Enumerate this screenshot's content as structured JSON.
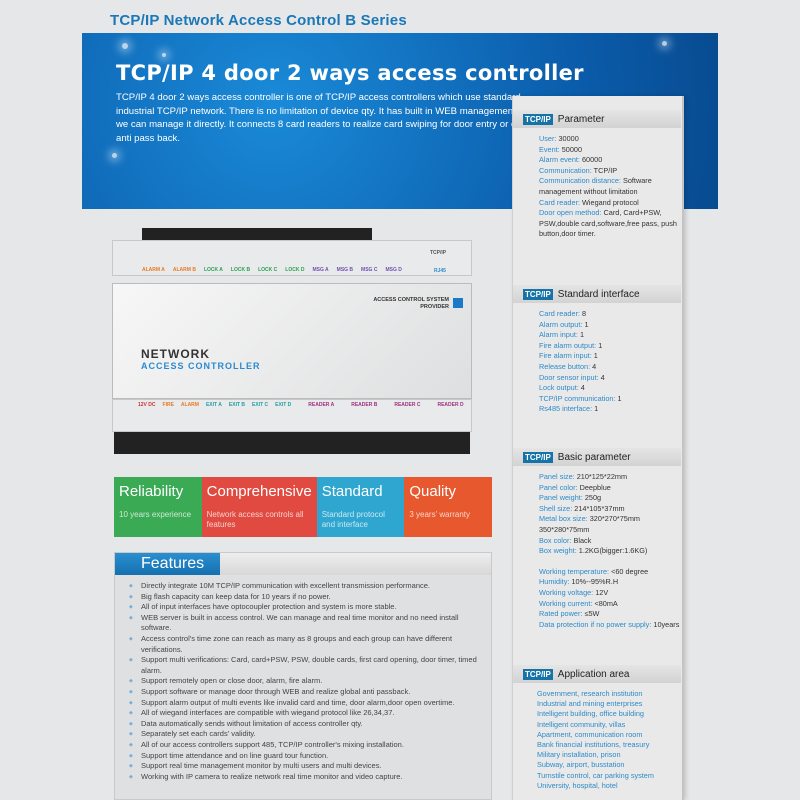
{
  "header": {
    "title": "TCP/IP Network Access Control  B  Series"
  },
  "banner": {
    "title": "TCP/IP 4 door  2 ways access controller",
    "description": "TCP/IP 4 door 2 ways access controller is one of TCP/IP access controllers which use standard industrial TCP/IP network. There is no limitation of device qty. It has built in WEB management and we can manage it directly. It connects 8 card readers to realize card swiping for door entry or exit and anti pass back."
  },
  "device": {
    "brand_line1": "NETWORK",
    "brand_line2": "ACCESS CONTROLLER",
    "provider": "ACCESS CONTROL SYSTEM PROVIDER",
    "port": "TCP/IP",
    "port_sub": "RJ45",
    "top_labels": [
      "ALARM A",
      "ALARM B",
      "LOCK A",
      "LOCK B",
      "LOCK C",
      "LOCK D",
      "MSG A",
      "MSG B",
      "MSG C",
      "MSG D"
    ],
    "bottom_labels": [
      "12V DC",
      "FIRE",
      "ALARM",
      "EXIT A",
      "EXIT B",
      "EXIT C",
      "EXIT D",
      "READER A",
      "READER B",
      "READER C",
      "READER D"
    ]
  },
  "cards": [
    {
      "title": "Reliability",
      "sub": "10 years experience",
      "color": "#3aaa55"
    },
    {
      "title": "Comprehensive",
      "sub": "Network access controls all features",
      "color": "#e04a40"
    },
    {
      "title": "Standard",
      "sub": "Standard protocol and interface",
      "color": "#2fa6d0"
    },
    {
      "title": "Quality",
      "sub": "3 years' warranty",
      "color": "#e8582e"
    }
  ],
  "features": {
    "title": "Features",
    "items": [
      "Directly integrate 10M TCP/IP communication with excellent transmission performance.",
      "Big flash capacity can keep data for 10 years if no power.",
      "All of input interfaces have optocoupler protection and system is more stable.",
      "WEB server is built in access control. We can manage and real time monitor and no need install software.",
      "Access control's time zone can reach as many as 8 groups and each group can have different verifications.",
      "Support multi verifications: Card, card+PSW, PSW, double cards, first card opening, door timer, timed alarm.",
      "Support remotely open or close door, alarm, fire alarm.",
      "Support software or manage door through WEB and realize global anti passback.",
      "Support alarm output of multi events like invalid card and time, door alarm,door open overtime.",
      "All of wiegand interfaces are compatible with wiegand protocol like 26,34,37.",
      "Data automatically sends without limitation of access controller qty.",
      "Separately set each cards' validity.",
      "All of our access controllers support 485, TCP/IP controller's mixing installation.",
      "Support time attendance and on line guard tour function.",
      "Support real time management monitor by multi users and multi devices.",
      "Working with IP camera to realize network real time monitor and video capture."
    ]
  },
  "spec": {
    "logo": "TCP/IP",
    "parameter": {
      "title": "Parameter",
      "rows": [
        [
          "User:",
          "30000"
        ],
        [
          "Event:",
          "50000"
        ],
        [
          "Alarm event:",
          "60000"
        ],
        [
          "Communication:",
          "TCP/IP"
        ],
        [
          "Communication distance:",
          "Software management without limitation"
        ],
        [
          "Card reader:",
          "Wiegand protocol"
        ],
        [
          "Door open method:",
          "Card, Card+PSW, PSW,double card,software,free pass, push button,door timer."
        ]
      ]
    },
    "interface": {
      "title": "Standard  interface",
      "rows": [
        [
          "Card reader:",
          "8"
        ],
        [
          "Alarm output:",
          "1"
        ],
        [
          "Alarm input:",
          "1"
        ],
        [
          "Fire alarm output:",
          "1"
        ],
        [
          "Fire alarm input:",
          "1"
        ],
        [
          "Release button:",
          "4"
        ],
        [
          "Door sensor input:",
          "4"
        ],
        [
          "Lock output:",
          "4"
        ],
        [
          "TCP/IP  communication:",
          "1"
        ],
        [
          "Rs485  interface:",
          "1"
        ]
      ]
    },
    "basic": {
      "title": "Basic parameter",
      "rows": [
        [
          "Panel size:",
          "210*125*22mm"
        ],
        [
          "Panel color:",
          "Deepblue"
        ],
        [
          "Panel weight:",
          "250g"
        ],
        [
          "Shell size:",
          "214*105*37mm"
        ],
        [
          "Metal box size:",
          "320*270*75mm 350*280*75mm"
        ],
        [
          "Box color:",
          "Black"
        ],
        [
          "Box weight:",
          "1.2KG(bigger:1.6KG)"
        ],
        [
          "Working temperature:",
          "<60 degree"
        ],
        [
          "Humidity:",
          "10%--95%R.H"
        ],
        [
          "Working voltage:",
          "12V"
        ],
        [
          "Working current:",
          "<80mA"
        ],
        [
          "Rated power:",
          "≤5W"
        ],
        [
          "Data protection if no power supply:",
          "10years"
        ]
      ]
    },
    "application": {
      "title": "Application  area",
      "items": [
        "Government, research institution",
        "Industrial and mining enterprises",
        "Intelligent building, office building",
        "Intelligent community, villas",
        "Apartment, communication room",
        "Bank financial institutions, treasury",
        "Military installation, prison",
        "Subway, airport, busstation",
        "Turnstile control, car parking system",
        "University, hospital, hotel"
      ]
    }
  }
}
